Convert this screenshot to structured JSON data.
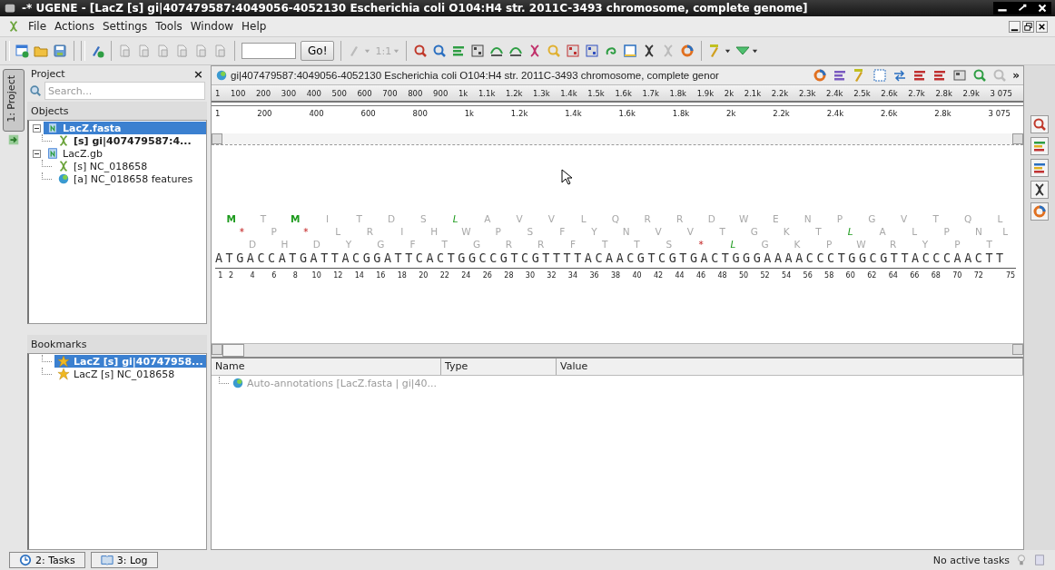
{
  "window": {
    "title": "-* UGENE - [LacZ [s] gi|407479587:4049056-4052130 Escherichia coli O104:H4 str. 2011C-3493 chromosome, complete genome]"
  },
  "menu": [
    {
      "label": "File"
    },
    {
      "label": "Actions"
    },
    {
      "label": "Settings"
    },
    {
      "label": "Tools"
    },
    {
      "label": "Window"
    },
    {
      "label": "Help"
    }
  ],
  "toolbar": {
    "go_button": "Go!",
    "zoom": {
      "label": "1:1",
      "disabled": true
    }
  },
  "side_tab": {
    "label": "1: Project",
    "selected": true
  },
  "project": {
    "title": "Project",
    "close": "×",
    "search_placeholder": "Search...",
    "objects_header": "Objects",
    "tree": [
      {
        "label": "LacZ.fasta",
        "selected": true,
        "expanded": true,
        "children": [
          {
            "label": "[s] gi|407479587:4...",
            "kind": "sequence",
            "active": true
          }
        ]
      },
      {
        "label": "LacZ.gb",
        "selected": false,
        "expanded": true,
        "children": [
          {
            "label": "[s] NC_018658",
            "kind": "sequence",
            "active": false
          },
          {
            "label": "[a] NC_018658 features",
            "kind": "annotation",
            "active": false
          }
        ]
      }
    ],
    "bookmarks_header": "Bookmarks",
    "bookmarks": [
      {
        "label": "LacZ [s] gi|40747958...",
        "selected": true
      },
      {
        "label": "LacZ [s] NC_018658",
        "selected": false
      }
    ]
  },
  "sequence_view": {
    "title": "gi|407479587:4049056-4052130 Escherichia coli O104:H4 str. 2011C-3493 chromosome, complete genor",
    "more": "»",
    "overview_ticks": [
      "1",
      "100",
      "200",
      "300",
      "400",
      "500",
      "600",
      "700",
      "800",
      "900",
      "1k",
      "1.1k",
      "1.2k",
      "1.3k",
      "1.4k",
      "1.5k",
      "1.6k",
      "1.7k",
      "1.8k",
      "1.9k",
      "2k",
      "2.1k",
      "2.2k",
      "2.3k",
      "2.4k",
      "2.5k",
      "2.6k",
      "2.7k",
      "2.8k",
      "2.9k",
      "3 075"
    ],
    "zoom_ticks": [
      "1",
      "200",
      "400",
      "600",
      "800",
      "1k",
      "1.2k",
      "1.4k",
      "1.6k",
      "1.8k",
      "2k",
      "2.2k",
      "2.4k",
      "2.6k",
      "2.8k",
      "3 075"
    ],
    "frames": [
      [
        {
          "aa": "M",
          "kind": "start"
        },
        {
          "aa": "T",
          "kind": "aa"
        },
        {
          "aa": "M",
          "kind": "start"
        },
        {
          "aa": "I",
          "kind": "aa"
        },
        {
          "aa": "T",
          "kind": "aa"
        },
        {
          "aa": "D",
          "kind": "aa"
        },
        {
          "aa": "S",
          "kind": "aa"
        },
        {
          "aa": "L",
          "kind": "alt_start"
        },
        {
          "aa": "A",
          "kind": "aa"
        },
        {
          "aa": "V",
          "kind": "aa"
        },
        {
          "aa": "V",
          "kind": "aa"
        },
        {
          "aa": "L",
          "kind": "aa"
        },
        {
          "aa": "Q",
          "kind": "aa"
        },
        {
          "aa": "R",
          "kind": "aa"
        },
        {
          "aa": "R",
          "kind": "aa"
        },
        {
          "aa": "D",
          "kind": "aa"
        },
        {
          "aa": "W",
          "kind": "aa"
        },
        {
          "aa": "E",
          "kind": "aa"
        },
        {
          "aa": "N",
          "kind": "aa"
        },
        {
          "aa": "P",
          "kind": "aa"
        },
        {
          "aa": "G",
          "kind": "aa"
        },
        {
          "aa": "V",
          "kind": "aa"
        },
        {
          "aa": "T",
          "kind": "aa"
        },
        {
          "aa": "Q",
          "kind": "aa"
        },
        {
          "aa": "L",
          "kind": "aa"
        }
      ],
      [
        {
          "aa": "*",
          "kind": "stop"
        },
        {
          "aa": "P",
          "kind": "aa"
        },
        {
          "aa": "*",
          "kind": "stop"
        },
        {
          "aa": "L",
          "kind": "aa"
        },
        {
          "aa": "R",
          "kind": "aa"
        },
        {
          "aa": "I",
          "kind": "aa"
        },
        {
          "aa": "H",
          "kind": "aa"
        },
        {
          "aa": "W",
          "kind": "aa"
        },
        {
          "aa": "P",
          "kind": "aa"
        },
        {
          "aa": "S",
          "kind": "aa"
        },
        {
          "aa": "F",
          "kind": "aa"
        },
        {
          "aa": "Y",
          "kind": "aa"
        },
        {
          "aa": "N",
          "kind": "aa"
        },
        {
          "aa": "V",
          "kind": "aa"
        },
        {
          "aa": "V",
          "kind": "aa"
        },
        {
          "aa": "T",
          "kind": "aa"
        },
        {
          "aa": "G",
          "kind": "aa"
        },
        {
          "aa": "K",
          "kind": "aa"
        },
        {
          "aa": "T",
          "kind": "aa"
        },
        {
          "aa": "L",
          "kind": "alt_start"
        },
        {
          "aa": "A",
          "kind": "aa"
        },
        {
          "aa": "L",
          "kind": "aa"
        },
        {
          "aa": "P",
          "kind": "aa"
        },
        {
          "aa": "N",
          "kind": "aa"
        },
        {
          "aa": "L",
          "kind": "aa"
        }
      ],
      [
        {
          "aa": "D",
          "kind": "aa"
        },
        {
          "aa": "H",
          "kind": "aa"
        },
        {
          "aa": "D",
          "kind": "aa"
        },
        {
          "aa": "Y",
          "kind": "aa"
        },
        {
          "aa": "G",
          "kind": "aa"
        },
        {
          "aa": "F",
          "kind": "aa"
        },
        {
          "aa": "T",
          "kind": "aa"
        },
        {
          "aa": "G",
          "kind": "aa"
        },
        {
          "aa": "R",
          "kind": "aa"
        },
        {
          "aa": "R",
          "kind": "aa"
        },
        {
          "aa": "F",
          "kind": "aa"
        },
        {
          "aa": "T",
          "kind": "aa"
        },
        {
          "aa": "T",
          "kind": "aa"
        },
        {
          "aa": "S",
          "kind": "aa"
        },
        {
          "aa": "*",
          "kind": "stop"
        },
        {
          "aa": "L",
          "kind": "alt_start"
        },
        {
          "aa": "G",
          "kind": "aa"
        },
        {
          "aa": "K",
          "kind": "aa"
        },
        {
          "aa": "P",
          "kind": "aa"
        },
        {
          "aa": "W",
          "kind": "aa"
        },
        {
          "aa": "R",
          "kind": "aa"
        },
        {
          "aa": "Y",
          "kind": "aa"
        },
        {
          "aa": "P",
          "kind": "aa"
        },
        {
          "aa": "T",
          "kind": "aa"
        }
      ]
    ],
    "sequence": "ATGACCATGATTACGGATTCACTGGCCGTCGTTTTACAACGTCGTGACTGGGAAAACCCTGGCGTTACCCAACTT",
    "ruler": [
      "1",
      "2",
      "4",
      "6",
      "8",
      "10",
      "12",
      "14",
      "16",
      "18",
      "20",
      "22",
      "24",
      "26",
      "28",
      "30",
      "32",
      "34",
      "36",
      "38",
      "40",
      "42",
      "44",
      "46",
      "48",
      "50",
      "52",
      "54",
      "56",
      "58",
      "60",
      "62",
      "64",
      "66",
      "68",
      "70",
      "72",
      "75"
    ]
  },
  "annotations": {
    "columns": [
      "Name",
      "Type",
      "Value"
    ],
    "rows": [
      {
        "name": "Auto-annotations [LacZ.fasta | gi|40...",
        "disabled": true
      }
    ]
  },
  "status_bar": {
    "tabs": [
      {
        "label": "2: Tasks",
        "kind": "tasks"
      },
      {
        "label": "3: Log",
        "kind": "log"
      }
    ],
    "message": "No active tasks"
  }
}
